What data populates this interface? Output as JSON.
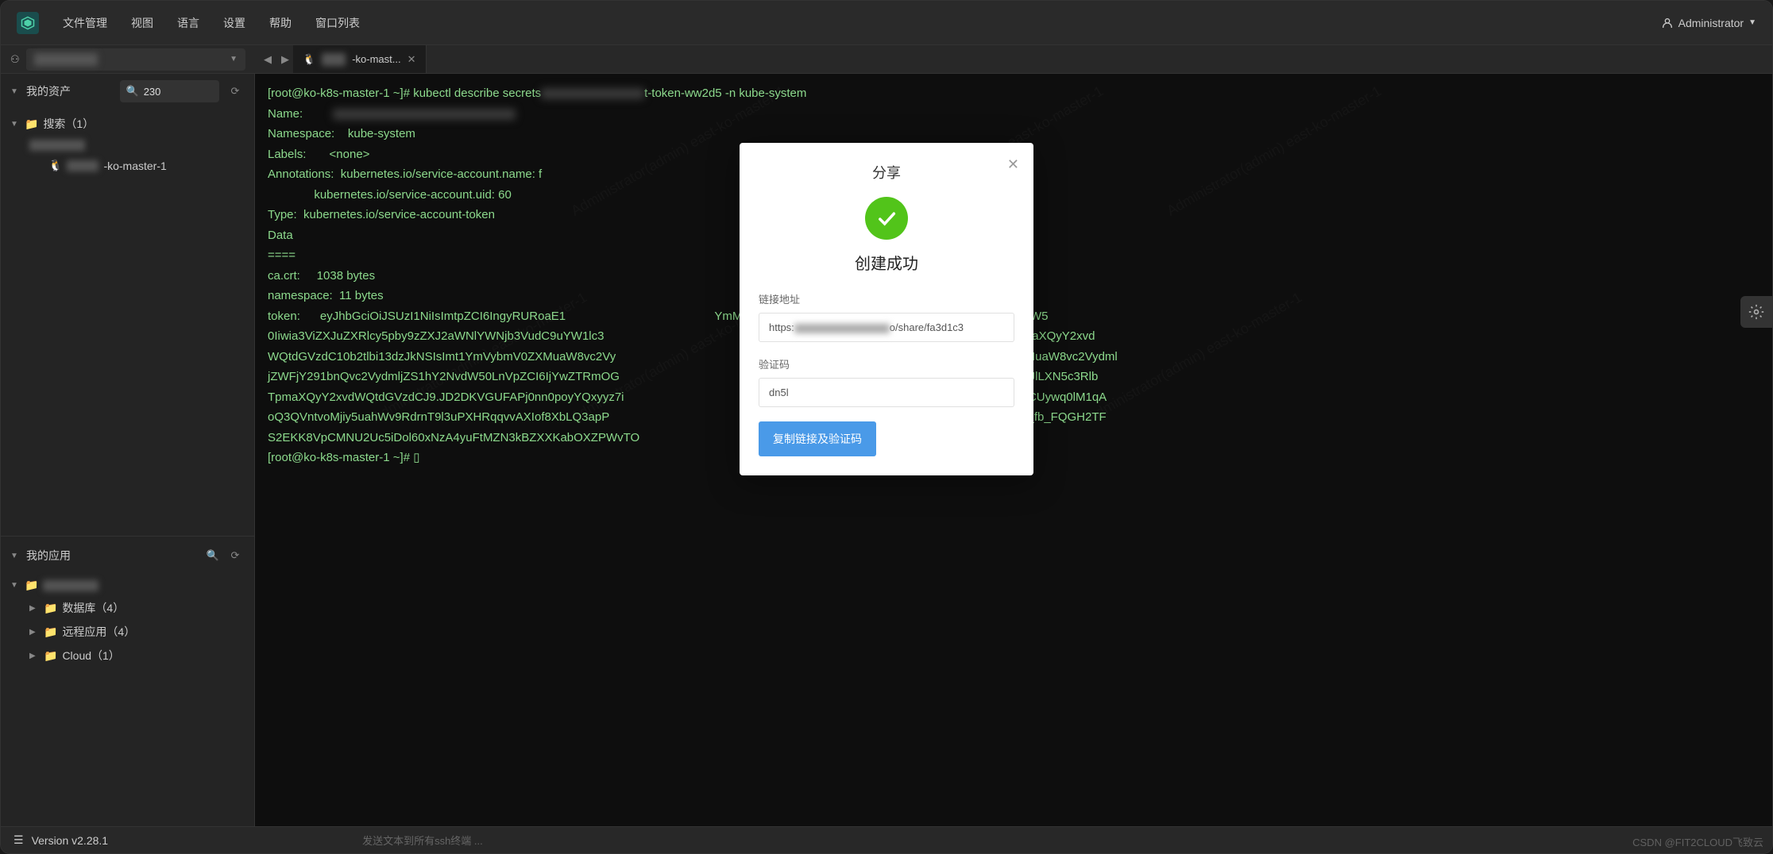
{
  "menu": {
    "file": "文件管理",
    "view": "视图",
    "language": "语言",
    "settings": "设置",
    "help": "帮助",
    "window_list": "窗口列表"
  },
  "user": {
    "name": "Administrator"
  },
  "tab": {
    "label": "-ko-mast..."
  },
  "sidebar": {
    "assets_title": "我的资产",
    "search_value": "230",
    "search_group": "搜索（1）",
    "host_label": "-ko-master-1",
    "apps_title": "我的应用",
    "db_label": "数据库（4）",
    "remote_label": "远程应用（4）",
    "cloud_label": "Cloud（1）"
  },
  "terminal": {
    "l1": "[root@ko-k8s-master-1 ~]# kubectl describe secrets",
    "l1b": "t-token-ww2d5 -n kube-system",
    "l2": "Name:",
    "l3": "Namespace:    kube-system",
    "l4": "Labels:       <none>",
    "l5": "Annotations:  kubernetes.io/service-account.name: f",
    "l6": "              kubernetes.io/service-account.uid: 60",
    "l7": "",
    "l8": "Type:  kubernetes.io/service-account-token",
    "l9": "",
    "l10": "Data",
    "l11": "====",
    "l12": "ca.crt:     1038 bytes",
    "l13": "namespace:  11 bytes",
    "l14": "token:      eyJhbGciOiJSUzI1NiIsImtpZCI6IngyRURoaE1",
    "l14b": "YmMifQ.eyJpc3MiOiJrdWJlcm5ldGVzL3NlcnZpY2VhY2NvdW5",
    "t1": "0Iiwia3ViZXJuZXRlcy5pby9zZXJ2aWNlYWNjb3VudC9uYW1lc3",
    "t1b": "vc2VydmljZWFjY291bnQvc2VjcmV0Lm5hbWUiOiJmaXQyY2xvd",
    "t2": "WQtdGVzdC10b2tlbi13dzJkNSIsImt1YmVybmV0ZXMuaW8vc2Vy",
    "t2b": "iJmaXQyY2xvdWQtdGVzdCIsImt1YmVybmV0ZXMuaW8vc2Vydml",
    "t3": "jZWFjY291bnQvc2VydmljZS1hY2NvdW50LnVpZCI6IjYwZTRmOG",
    "t3b": "1YiI6InN5c3RlbTpzZXJ2aWNlYWNjb3VudDprdWJlLXN5c3Rlb",
    "t4": "TpmaXQyY2xvdWQtdGVzdCJ9.JD2DKVGUFAPj0nn0poyYQxyyz7i",
    "t4b": "0jrXkfESDHCoL1OY6AXFi8QbpFvGi-YWthtlFcbCUywq0lM1qA",
    "t5": "oQ3QVntvoMjiy5uahWv9RdrnT9l3uPXHRqqvvAXIof8XbLQ3apP",
    "t5b": "6QMzuFghXmMNwlVifWleGtfUfwsqo3sVvBPWvdu_fb_FQGH2TF",
    "t6": "S2EKK8VpCMNU2Uc5iDol60xNzA4yuFtMZN3kBZXXKabOXZPWvTO",
    "t7": "[root@ko-k8s-master-1 ~]# ▯"
  },
  "modal": {
    "title": "分享",
    "success": "创建成功",
    "url_label": "链接地址",
    "url_prefix": "https:",
    "url_suffix": "o/share/fa3d1c3",
    "code_label": "验证码",
    "code_value": "dn5l",
    "copy_btn": "复制链接及验证码"
  },
  "status": {
    "version": "Version v2.28.1",
    "hint": "发送文本到所有ssh终端 ..."
  },
  "watermark_text": "Administrator(admin)\neast-ko-master-1",
  "csdn": "CSDN @FIT2CLOUD飞致云"
}
